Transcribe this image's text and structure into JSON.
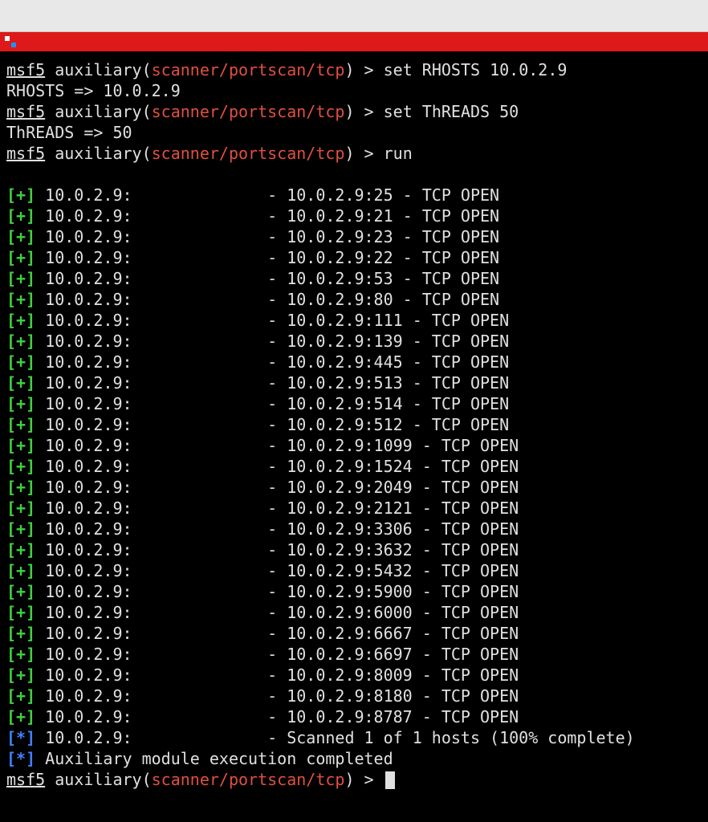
{
  "prompt": {
    "msf": "msf5",
    "aux_open": " auxiliary(",
    "module": "scanner/portscan/tcp",
    "aux_close": ") ",
    "gt": "> "
  },
  "commands": [
    {
      "cmd": "set RHOSTS 10.0.2.9",
      "echo": "RHOSTS => 10.0.2.9"
    },
    {
      "cmd": "set ThREADS 50",
      "echo": "ThREADS => 50"
    },
    {
      "cmd": "run",
      "echo": ""
    }
  ],
  "host": "10.0.2.9",
  "results": [
    {
      "sym": "[+]",
      "ip": "10.0.2.9:",
      "detail": "10.0.2.9:25 - TCP OPEN"
    },
    {
      "sym": "[+]",
      "ip": "10.0.2.9:",
      "detail": "10.0.2.9:21 - TCP OPEN"
    },
    {
      "sym": "[+]",
      "ip": "10.0.2.9:",
      "detail": "10.0.2.9:23 - TCP OPEN"
    },
    {
      "sym": "[+]",
      "ip": "10.0.2.9:",
      "detail": "10.0.2.9:22 - TCP OPEN"
    },
    {
      "sym": "[+]",
      "ip": "10.0.2.9:",
      "detail": "10.0.2.9:53 - TCP OPEN"
    },
    {
      "sym": "[+]",
      "ip": "10.0.2.9:",
      "detail": "10.0.2.9:80 - TCP OPEN"
    },
    {
      "sym": "[+]",
      "ip": "10.0.2.9:",
      "detail": "10.0.2.9:111 - TCP OPEN"
    },
    {
      "sym": "[+]",
      "ip": "10.0.2.9:",
      "detail": "10.0.2.9:139 - TCP OPEN"
    },
    {
      "sym": "[+]",
      "ip": "10.0.2.9:",
      "detail": "10.0.2.9:445 - TCP OPEN"
    },
    {
      "sym": "[+]",
      "ip": "10.0.2.9:",
      "detail": "10.0.2.9:513 - TCP OPEN"
    },
    {
      "sym": "[+]",
      "ip": "10.0.2.9:",
      "detail": "10.0.2.9:514 - TCP OPEN"
    },
    {
      "sym": "[+]",
      "ip": "10.0.2.9:",
      "detail": "10.0.2.9:512 - TCP OPEN"
    },
    {
      "sym": "[+]",
      "ip": "10.0.2.9:",
      "detail": "10.0.2.9:1099 - TCP OPEN"
    },
    {
      "sym": "[+]",
      "ip": "10.0.2.9:",
      "detail": "10.0.2.9:1524 - TCP OPEN"
    },
    {
      "sym": "[+]",
      "ip": "10.0.2.9:",
      "detail": "10.0.2.9:2049 - TCP OPEN"
    },
    {
      "sym": "[+]",
      "ip": "10.0.2.9:",
      "detail": "10.0.2.9:2121 - TCP OPEN"
    },
    {
      "sym": "[+]",
      "ip": "10.0.2.9:",
      "detail": "10.0.2.9:3306 - TCP OPEN"
    },
    {
      "sym": "[+]",
      "ip": "10.0.2.9:",
      "detail": "10.0.2.9:3632 - TCP OPEN"
    },
    {
      "sym": "[+]",
      "ip": "10.0.2.9:",
      "detail": "10.0.2.9:5432 - TCP OPEN"
    },
    {
      "sym": "[+]",
      "ip": "10.0.2.9:",
      "detail": "10.0.2.9:5900 - TCP OPEN"
    },
    {
      "sym": "[+]",
      "ip": "10.0.2.9:",
      "detail": "10.0.2.9:6000 - TCP OPEN"
    },
    {
      "sym": "[+]",
      "ip": "10.0.2.9:",
      "detail": "10.0.2.9:6667 - TCP OPEN"
    },
    {
      "sym": "[+]",
      "ip": "10.0.2.9:",
      "detail": "10.0.2.9:6697 - TCP OPEN"
    },
    {
      "sym": "[+]",
      "ip": "10.0.2.9:",
      "detail": "10.0.2.9:8009 - TCP OPEN"
    },
    {
      "sym": "[+]",
      "ip": "10.0.2.9:",
      "detail": "10.0.2.9:8180 - TCP OPEN"
    },
    {
      "sym": "[+]",
      "ip": "10.0.2.9:",
      "detail": "10.0.2.9:8787 - TCP OPEN"
    },
    {
      "sym": "[*]",
      "ip": "10.0.2.9:",
      "detail": "Scanned 1 of 1 hosts (100% complete)"
    }
  ],
  "final_line": {
    "sym": "[*]",
    "text": "Auxiliary module execution completed"
  }
}
